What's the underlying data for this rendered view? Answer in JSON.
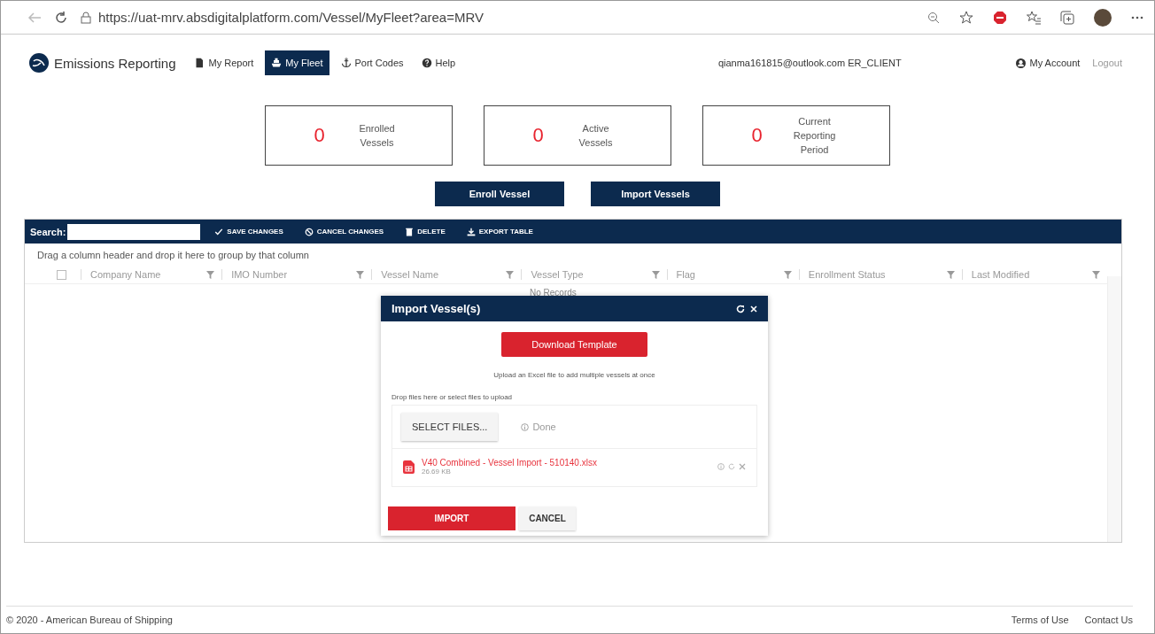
{
  "browser": {
    "url": "https://uat-mrv.absdigitalplatform.com/Vessel/MyFleet?area=MRV"
  },
  "nav": {
    "brand": "Emissions Reporting",
    "items": [
      {
        "label": "My Report",
        "kind": "report",
        "selected": false
      },
      {
        "label": "My Fleet",
        "kind": "fleet",
        "selected": true
      },
      {
        "label": "Port Codes",
        "kind": "ports",
        "selected": false
      },
      {
        "label": "Help",
        "kind": "help",
        "selected": false
      }
    ],
    "user": "qianma161815@outlook.com ER_CLIENT",
    "account": "My Account",
    "logout": "Logout"
  },
  "tiles": [
    {
      "count": "0",
      "label": "Enrolled Vessels"
    },
    {
      "count": "0",
      "label": "Active Vessels"
    },
    {
      "count": "0",
      "label": "Current Reporting Period"
    }
  ],
  "actions": [
    "Enroll Vessel",
    "Import Vessels"
  ],
  "grid": {
    "search_label": "Search:",
    "toolbar": [
      {
        "label": "SAVE CHANGES",
        "kind": "save"
      },
      {
        "label": "CANCEL CHANGES",
        "kind": "cancel"
      },
      {
        "label": "DELETE",
        "kind": "delete"
      },
      {
        "label": "EXPORT TABLE",
        "kind": "export"
      }
    ],
    "group_hint": "Drag a column header and drop it here to group by that column",
    "select_all": {
      "checked": false
    },
    "columns": [
      "Company Name",
      "IMO Number",
      "Vessel Name",
      "Vessel Type",
      "Flag",
      "Enrollment Status",
      "Last Modified"
    ],
    "empty_text": "No Records"
  },
  "dialog": {
    "title": "Import Vessel(s)",
    "download_button": "Download Template",
    "hint": "Upload an Excel file to add multiple vessels at once",
    "drop_hint": "Drop files here or select files to upload",
    "select_button": "SELECT FILES...",
    "status": "Done",
    "file": {
      "name": "V40 Combined - Vessel Import - 510140.xlsx",
      "size": "26.69 KB"
    },
    "buttons": [
      {
        "label": "IMPORT",
        "kind": "primary"
      },
      {
        "label": "CANCEL",
        "kind": "secondary"
      }
    ]
  },
  "footer": {
    "copyright": "© 2020 - American Bureau of Shipping",
    "links": [
      "Terms of Use",
      "Contact Us"
    ]
  }
}
